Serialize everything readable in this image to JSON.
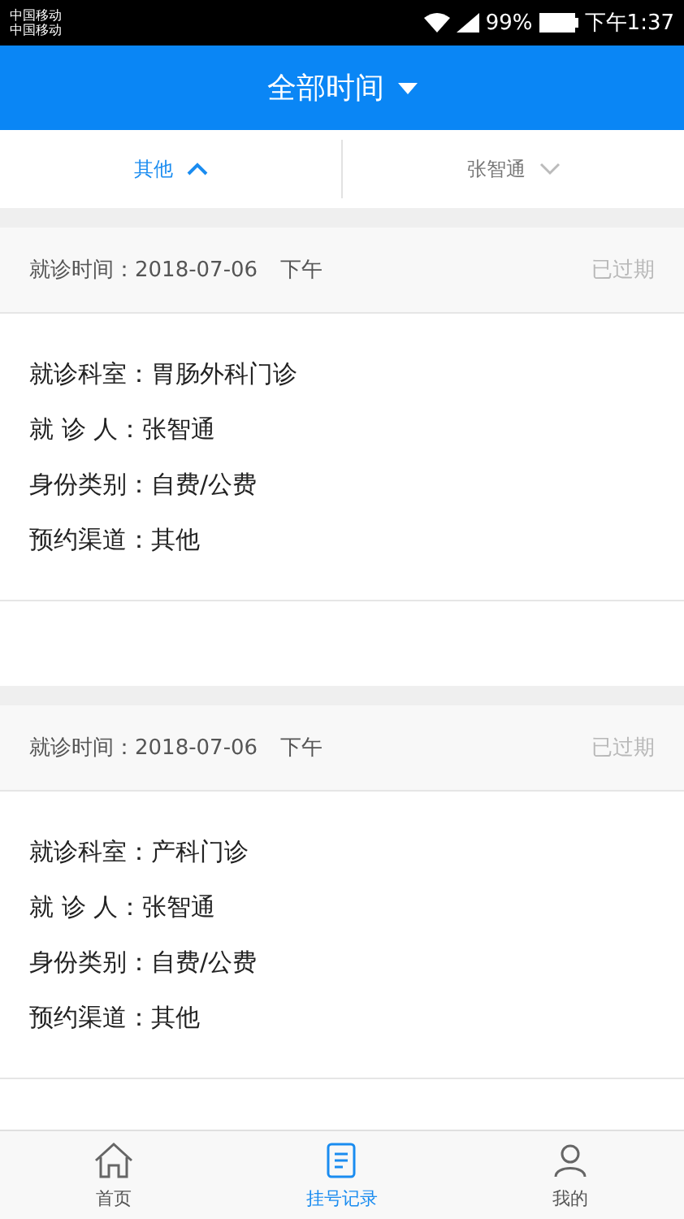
{
  "status_bar": {
    "carriers": [
      "中国移动",
      "中国移动"
    ],
    "battery": "99%",
    "time": "下午1:37"
  },
  "header": {
    "title": "全部时间"
  },
  "filters": [
    {
      "label": "其他",
      "expanded": true
    },
    {
      "label": "张智通",
      "expanded": false
    }
  ],
  "records": [
    {
      "time_label": "就诊时间：",
      "time": "2018-07-06",
      "period": "下午",
      "status": "已过期",
      "fields": [
        {
          "label": "就诊科室：",
          "value": "胃肠外科门诊"
        },
        {
          "label": "就 诊 人：",
          "value": "张智通"
        },
        {
          "label": "身份类别：",
          "value": "自费/公费"
        },
        {
          "label": "预约渠道：",
          "value": "其他"
        }
      ]
    },
    {
      "time_label": "就诊时间：",
      "time": "2018-07-06",
      "period": "下午",
      "status": "已过期",
      "fields": [
        {
          "label": "就诊科室：",
          "value": "产科门诊"
        },
        {
          "label": "就 诊 人：",
          "value": "张智通"
        },
        {
          "label": "身份类别：",
          "value": "自费/公费"
        },
        {
          "label": "预约渠道：",
          "value": "其他"
        }
      ]
    }
  ],
  "tab_bar": [
    {
      "label": "首页",
      "kind": "home",
      "selected": false
    },
    {
      "label": "挂号记录",
      "kind": "records",
      "selected": true
    },
    {
      "label": "我的",
      "kind": "profile",
      "selected": false
    }
  ]
}
